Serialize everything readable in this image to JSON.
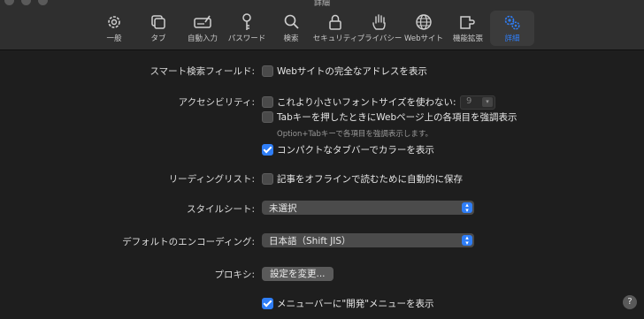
{
  "window": {
    "title": "詳細"
  },
  "tabs": [
    {
      "label": "一般",
      "icon": "gear-icon"
    },
    {
      "label": "タブ",
      "icon": "tabs-icon"
    },
    {
      "label": "自動入力",
      "icon": "autofill-icon"
    },
    {
      "label": "パスワード",
      "icon": "key-icon"
    },
    {
      "label": "検索",
      "icon": "search-icon"
    },
    {
      "label": "セキュリティ",
      "icon": "lock-icon"
    },
    {
      "label": "プライバシー",
      "icon": "hand-icon"
    },
    {
      "label": "Webサイト",
      "icon": "globe-icon"
    },
    {
      "label": "機能拡張",
      "icon": "puzzle-icon"
    },
    {
      "label": "詳細",
      "icon": "gears-icon",
      "active": true
    }
  ],
  "smart_search": {
    "label": "スマート検索フィールド:",
    "option": "Webサイトの完全なアドレスを表示",
    "checked": false
  },
  "accessibility": {
    "label": "アクセシビリティ:",
    "font_option": "これより小さいフォントサイズを使わない:",
    "font_checked": false,
    "font_size": "9",
    "tab_option": "Tabキーを押したときにWebページ上の各項目を強調表示",
    "tab_checked": false,
    "tab_hint": "Option+Tabキーで各項目を強調表示します。",
    "compact_option": "コンパクトなタブバーでカラーを表示",
    "compact_checked": true
  },
  "reading_list": {
    "label": "リーディングリスト:",
    "option": "記事をオフラインで読むために自動的に保存",
    "checked": false
  },
  "stylesheet": {
    "label": "スタイルシート:",
    "value": "未選択"
  },
  "encoding": {
    "label": "デフォルトのエンコーディング:",
    "value": "日本語（Shift JIS）"
  },
  "proxy": {
    "label": "プロキシ:",
    "button": "設定を変更..."
  },
  "develop_menu": {
    "option": "メニューバーに\"開発\"メニューを表示",
    "checked": true
  },
  "help": {
    "label": "?"
  },
  "colors": {
    "accent": "#2f7ef7",
    "background": "#1e1e1e",
    "toolbar": "#2f2f2f"
  }
}
